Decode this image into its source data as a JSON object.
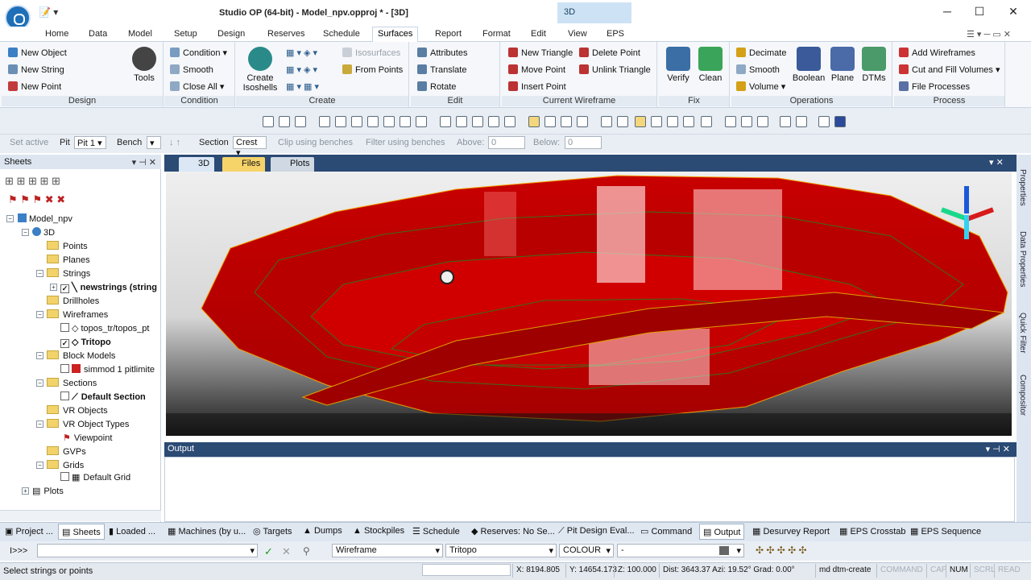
{
  "window": {
    "title": "Studio OP (64-bit) - Model_npv.opproj * - [3D]",
    "context_tab": "3D",
    "controls": {
      "minimize": "─",
      "maximize": "☐",
      "close": "✕"
    }
  },
  "quick_access": "📝 ▾",
  "ribbon_tabs": [
    "Home",
    "Data",
    "Model",
    "Setup",
    "Design",
    "Reserves",
    "Schedule",
    "Surfaces",
    "Report",
    "Format",
    "Edit",
    "View",
    "EPS"
  ],
  "active_tab": "Surfaces",
  "ribbon": {
    "design": {
      "label": "Design",
      "new_object": "New Object",
      "new_string": "New String",
      "new_point": "New Point",
      "tools": "Tools"
    },
    "condition": {
      "label": "Condition",
      "condition": "Condition",
      "smooth": "Smooth",
      "close_all": "Close All"
    },
    "create": {
      "label": "Create",
      "create_isoshells": "Create Isoshells",
      "isosurfaces": "Isosurfaces",
      "from_points": "From Points"
    },
    "edit": {
      "label": "Edit",
      "attributes": "Attributes",
      "translate": "Translate",
      "rotate": "Rotate"
    },
    "current_wireframe": {
      "label": "Current Wireframe",
      "new_triangle": "New Triangle",
      "move_point": "Move Point",
      "insert_point": "Insert Point",
      "delete_point": "Delete Point",
      "unlink_triangle": "Unlink Triangle"
    },
    "fix": {
      "label": "Fix",
      "verify": "Verify",
      "clean": "Clean"
    },
    "operations": {
      "label": "Operations",
      "decimate": "Decimate",
      "smooth": "Smooth",
      "volume": "Volume",
      "boolean": "Boolean",
      "plane": "Plane",
      "dtms": "DTMs"
    },
    "process": {
      "label": "Process",
      "add_wireframes": "Add Wireframes",
      "cut_fill": "Cut and Fill Volumes",
      "file_processes": "File Processes"
    }
  },
  "toolbar2": {
    "set_active": "Set active",
    "pit_label": "Pit",
    "pit_value": "Pit 1",
    "bench_label": "Bench",
    "bench_value": "",
    "section_label": "Section",
    "section_value": "Crest",
    "clip": "Clip using benches",
    "filter": "Filter using benches",
    "above_label": "Above:",
    "above_value": "0",
    "below_label": "Below:",
    "below_value": "0"
  },
  "sheets": {
    "title": "Sheets",
    "tree": {
      "root": "Model_npv",
      "n3d": "3D",
      "points": "Points",
      "planes": "Planes",
      "strings": "Strings",
      "newstrings": "newstrings (string",
      "drillholes": "Drillholes",
      "wireframes": "Wireframes",
      "topos": "topos_tr/topos_pt",
      "tritopo": "Tritopo",
      "block_models": "Block Models",
      "simmod": "simmod 1 pitlimite",
      "sections": "Sections",
      "default_section": "Default Section",
      "vr_objects": "VR Objects",
      "vr_object_types": "VR Object Types",
      "viewpoint": "Viewpoint",
      "gvps": "GVPs",
      "grids": "Grids",
      "default_grid": "Default Grid",
      "plots": "Plots"
    }
  },
  "view_tabs": [
    "3D",
    "Files",
    "Plots"
  ],
  "right_strip": [
    "Properties",
    "Data Properties",
    "Quick Filter",
    "Compositor"
  ],
  "output": {
    "title": "Output"
  },
  "bottom_tabs": [
    "Project ...",
    "Sheets",
    "Loaded ...",
    "Machines (by u...",
    "Targets",
    "Dumps",
    "Stockpiles",
    "Schedule",
    "Reserves: No Se...",
    "Pit Design Eval...",
    "Command",
    "Output",
    "Desurvey Report",
    "EPS Crosstab",
    "EPS Sequence"
  ],
  "command": {
    "prompt": "I>>>",
    "value": "",
    "layer": "Wireframe",
    "object": "Tritopo",
    "colour": "COLOUR",
    "dash": "-"
  },
  "status": {
    "message": "Select strings or points",
    "x": "X: 8194.805",
    "y": "Y: 14654.173",
    "z": "Z: 100.000",
    "dist": "Dist: 3643.37 Azi: 19.52° Grad: 0.00°",
    "cmd": "md dtm-create",
    "command_flag": "COMMAND",
    "cap": "CAP",
    "num": "NUM",
    "scrl": "SCRL",
    "read": "READ"
  },
  "colors": {
    "surface": "#d40000",
    "accent": "#2b4a74",
    "ribbon_bg": "#f5f7fa"
  }
}
